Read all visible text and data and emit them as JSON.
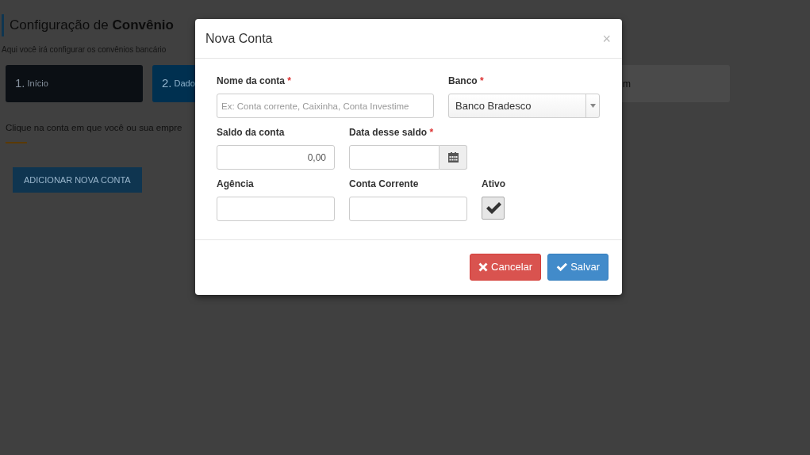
{
  "page": {
    "title": "Configuração de **Convênio**",
    "subtitle": "Aqui você irá configurar os convênios bancário",
    "steps": [
      {
        "number": "1.",
        "label": "Início",
        "kind": "done"
      },
      {
        "number": "2.",
        "label": "Dado",
        "kind": "current"
      },
      {
        "label": "m",
        "kind": "pending"
      }
    ],
    "instruction": "Clique na conta em que você ou sua empre",
    "add_button": "ADICIONAR NOVA CONTA"
  },
  "modal": {
    "title": "Nova Conta",
    "close": "×",
    "fields": [
      {
        "kind": "text",
        "label": "Nome da conta",
        "required_mark": "*",
        "placeholder": "Ex: Conta corrente, Caixinha, Conta Investime"
      },
      {
        "kind": "select",
        "label": "Banco",
        "required_mark": "*",
        "value": "Banco Bradesco"
      },
      {
        "kind": "money",
        "label": "Saldo da conta",
        "value": "0,00"
      },
      {
        "kind": "date",
        "label": "Data desse saldo",
        "required_mark": "*"
      },
      {
        "kind": "text",
        "label": "Agência"
      },
      {
        "kind": "text",
        "label": "Conta Corrente"
      },
      {
        "kind": "checkbox",
        "label": "Ativo",
        "checked": true
      }
    ],
    "buttons": [
      {
        "kind": "cancel",
        "label": "Cancelar"
      },
      {
        "kind": "save",
        "label": "Salvar"
      }
    ]
  }
}
